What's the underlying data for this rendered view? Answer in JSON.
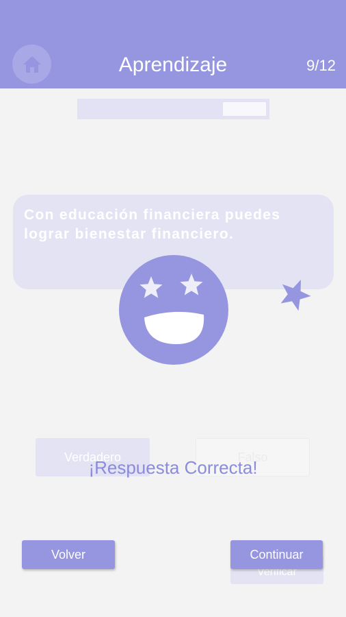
{
  "header": {
    "title": "Aprendizaje",
    "counter": "9/12",
    "home_icon": "home-icon",
    "background_color": "#9595e0"
  },
  "progress": {
    "current": 9,
    "total": 12,
    "fraction": 0.75
  },
  "question": {
    "text": "Con educación financiera puedes lograr bienestar financiero."
  },
  "answers": {
    "true_label": "Verdadero",
    "false_label": "Falso"
  },
  "feedback": {
    "text": "¡Respuesta Correcta!",
    "icon": "star-eyes-smiley-icon"
  },
  "footer": {
    "back_label": "Volver",
    "verify_label": "Verificar",
    "continue_label": "Continuar"
  }
}
